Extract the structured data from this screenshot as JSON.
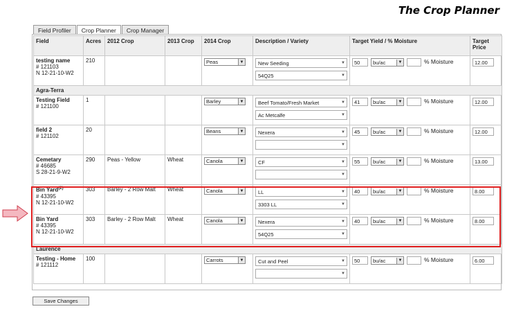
{
  "app_title": "The Crop Planner",
  "tabs": [
    {
      "label": "Field Profiler",
      "active": false
    },
    {
      "label": "Crop Planner",
      "active": true
    },
    {
      "label": "Crop Manager",
      "active": false
    }
  ],
  "headers": {
    "field": "Field",
    "acres": "Acres",
    "crop_2012": "2012 Crop",
    "crop_2013": "2013 Crop",
    "crop_2014": "2014 Crop",
    "desc": "Description / Variety",
    "yield": "Target Yield / % Moisture",
    "price": "Target Price"
  },
  "moisture_label": "% Moisture",
  "groups": [
    {
      "name": "",
      "rows": [
        {
          "name": "testing name",
          "sup": "",
          "id": "# 121103",
          "legal": "N 12-21-10-W2",
          "acres": "210",
          "c2012": "",
          "c2013": "",
          "c2014": "Peas",
          "desc": "New Seeding",
          "variety": "54Q25",
          "yield": "50",
          "unit": "bu/ac",
          "moisture": "",
          "price": "12.00"
        }
      ]
    },
    {
      "name": "Agra-Terra",
      "rows": [
        {
          "name": "Testing Field",
          "sup": "",
          "id": "# 121100",
          "legal": "",
          "acres": "1",
          "c2012": "",
          "c2013": "",
          "c2014": "Barley",
          "desc": "Beef Tomato/Fresh Market",
          "variety": "Ac Metcalfe",
          "yield": "41",
          "unit": "bu/ac",
          "moisture": "",
          "price": "12.00"
        },
        {
          "name": "field 2",
          "sup": "",
          "id": "# 121102",
          "legal": "",
          "acres": "20",
          "c2012": "",
          "c2013": "",
          "c2014": "Beans",
          "desc": "Nexera",
          "variety": "",
          "yield": "45",
          "unit": "bu/ac",
          "moisture": "",
          "price": "12.00"
        },
        {
          "name": "Cemetary",
          "sup": "",
          "id": "# 46685",
          "legal": "S 28-21-9-W2",
          "acres": "290",
          "c2012": "Peas - Yellow",
          "c2013": "Wheat",
          "c2014": "Canola",
          "desc": "CF",
          "variety": "",
          "yield": "55",
          "unit": "bu/ac",
          "moisture": "",
          "price": "13.00"
        },
        {
          "name": "Bin Yard",
          "sup": "(2)",
          "id": "# 43395",
          "legal": "N 12-21-10-W2",
          "acres": "303",
          "c2012": "Barley - 2 Row Malt",
          "c2013": "Wheat",
          "c2014": "Canola",
          "desc": "LL",
          "variety": "3303 LL",
          "yield": "40",
          "unit": "bu/ac",
          "moisture": "",
          "price": "8.00"
        },
        {
          "name": "Bin Yard",
          "sup": "",
          "id": "# 43395",
          "legal": "N 12-21-10-W2",
          "acres": "303",
          "c2012": "Barley - 2 Row Malt",
          "c2013": "Wheat",
          "c2014": "Canola",
          "desc": "Nexera",
          "variety": "54Q25",
          "yield": "40",
          "unit": "bu/ac",
          "moisture": "",
          "price": "8.00"
        }
      ]
    },
    {
      "name": "Laurence",
      "rows": [
        {
          "name": "Testing - Home",
          "sup": "",
          "id": "# 121112",
          "legal": "",
          "acres": "100",
          "c2012": "",
          "c2013": "",
          "c2014": "Carrots",
          "desc": "Cut and Peel",
          "variety": "",
          "yield": "50",
          "unit": "bu/ac",
          "moisture": "",
          "price": "6.00"
        }
      ]
    }
  ],
  "save_button": "Save Changes",
  "colors": {
    "highlight": "#e02020",
    "pointer_fill": "#f4b8c0",
    "pointer_stroke": "#d04050"
  }
}
